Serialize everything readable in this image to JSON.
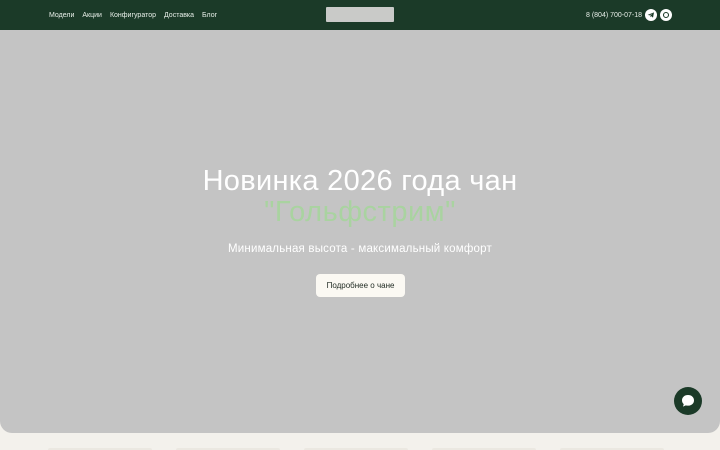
{
  "header": {
    "nav": [
      {
        "label": "Модели"
      },
      {
        "label": "Акции"
      },
      {
        "label": "Конфигуратор"
      },
      {
        "label": "Доставка"
      },
      {
        "label": "Блог"
      }
    ],
    "phone": "8 (804) 700-07-18",
    "social_icons": [
      "telegram-icon",
      "max-messenger-icon"
    ]
  },
  "hero": {
    "title": "Новинка 2026 года чан",
    "accent": "\"Гольфстрим\"",
    "subtitle": "Минимальная высота - максимальный комфорт",
    "cta_label": "Подробнее о чане"
  },
  "colors": {
    "header_bg": "#1b3a28",
    "hero_bg": "#c4c4c4",
    "accent_text": "#a9d3a0",
    "button_bg": "#fbf9f3"
  },
  "chat": {
    "icon": "chat-bubble-icon"
  }
}
